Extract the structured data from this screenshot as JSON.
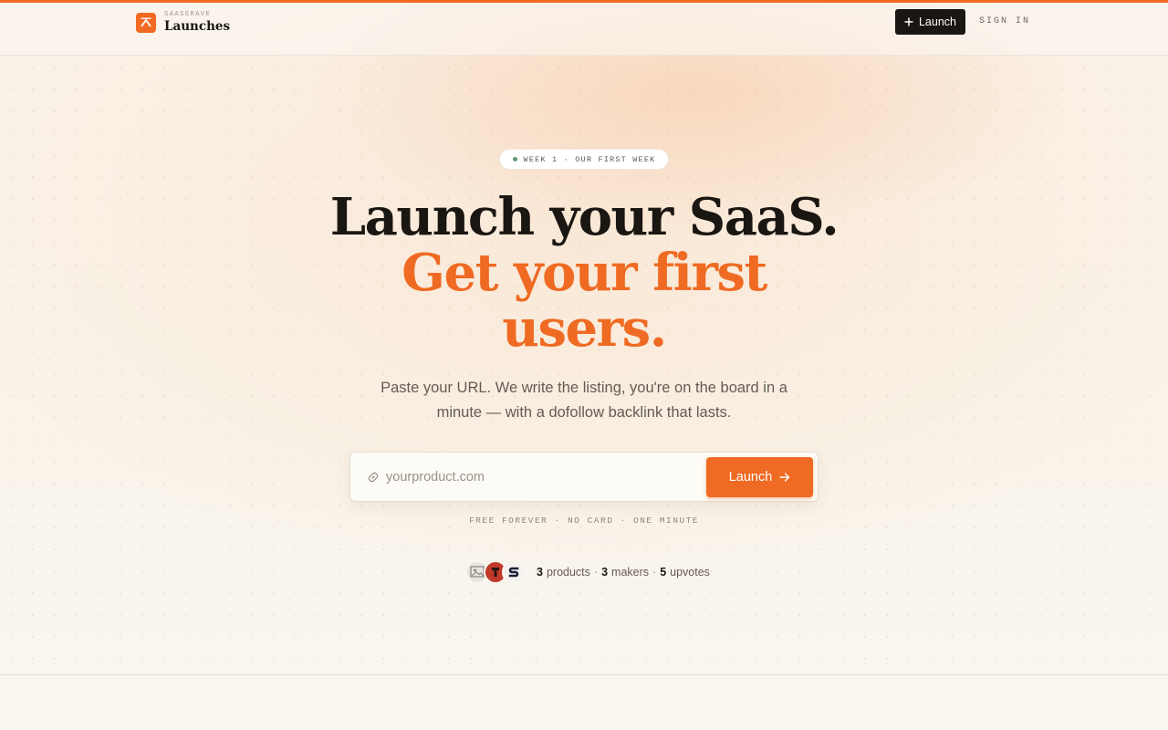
{
  "colors": {
    "accent": "#ef6a22",
    "dark": "#1a1612",
    "status_dot": "#5e9a79"
  },
  "header": {
    "brand_kicker": "SAASGRAVE",
    "brand_name": "Launches",
    "brand_icon": "launch-arrow-icon",
    "launch_button": "Launch",
    "sign_in": "SIGN IN"
  },
  "hero": {
    "badge": "WEEK 1 · OUR FIRST WEEK",
    "headline_line1": "Launch your SaaS.",
    "headline_line2a": "Get your first",
    "headline_line2b": "users.",
    "subtitle": "Paste your URL. We write the listing, you're on the board in a minute — with a dofollow backlink that lasts."
  },
  "form": {
    "placeholder": "yourproduct.com",
    "value": "",
    "submit_label": "Launch",
    "link_icon": "link-icon",
    "arrow_icon": "arrow-right-icon"
  },
  "fineprint": "FREE FOREVER · NO CARD · ONE MINUTE",
  "social_proof": {
    "products_count": "3",
    "products_label": "products",
    "makers_count": "3",
    "makers_label": "makers",
    "upvotes_count": "5",
    "upvotes_label": "upvotes",
    "separator": "·"
  }
}
